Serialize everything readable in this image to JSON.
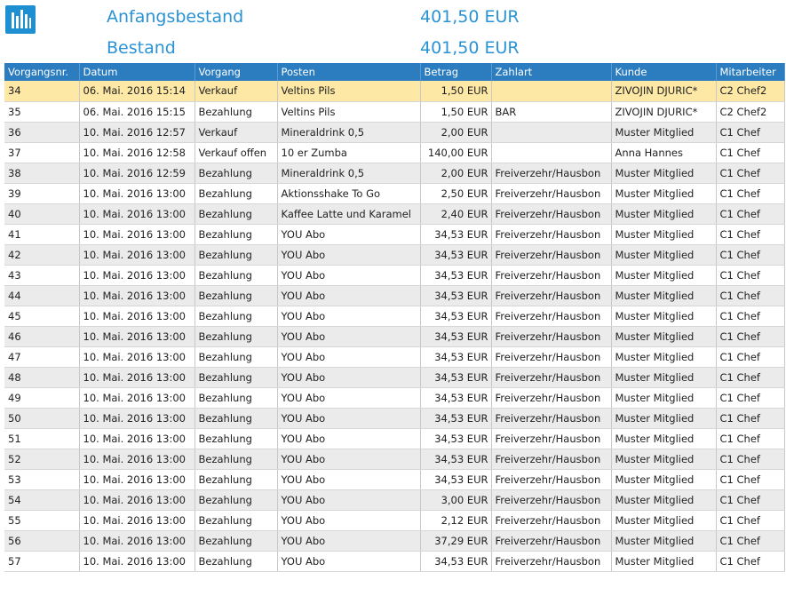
{
  "summary": {
    "opening_label": "Anfangsbestand",
    "opening_value": "401,50 EUR",
    "balance_label": "Bestand",
    "balance_value": "401,50 EUR"
  },
  "table": {
    "columns": [
      "Vorgangsnr.",
      "Datum",
      "Vorgang",
      "Posten",
      "Betrag",
      "Zahlart",
      "Kunde",
      "Mitarbeiter"
    ],
    "rows": [
      [
        "34",
        "06. Mai. 2016 15:14",
        "Verkauf",
        "Veltins Pils",
        "1,50 EUR",
        "",
        "ZIVOJIN DJURIC*",
        "C2 Chef2"
      ],
      [
        "35",
        "06. Mai. 2016 15:15",
        "Bezahlung",
        "Veltins Pils",
        "1,50 EUR",
        "BAR",
        "ZIVOJIN DJURIC*",
        "C2 Chef2"
      ],
      [
        "36",
        "10. Mai. 2016 12:57",
        "Verkauf",
        "Mineraldrink 0,5",
        "2,00 EUR",
        "",
        "Muster Mitglied",
        "C1 Chef"
      ],
      [
        "37",
        "10. Mai. 2016 12:58",
        "Verkauf offen",
        "10 er Zumba",
        "140,00 EUR",
        "",
        "Anna Hannes",
        "C1 Chef"
      ],
      [
        "38",
        "10. Mai. 2016 12:59",
        "Bezahlung",
        "Mineraldrink 0,5",
        "2,00 EUR",
        "Freiverzehr/Hausbon",
        "Muster Mitglied",
        "C1 Chef"
      ],
      [
        "39",
        "10. Mai. 2016 13:00",
        "Bezahlung",
        "Aktionsshake To Go",
        "2,50 EUR",
        "Freiverzehr/Hausbon",
        "Muster Mitglied",
        "C1 Chef"
      ],
      [
        "40",
        "10. Mai. 2016 13:00",
        "Bezahlung",
        "Kaffee Latte und Karamel",
        "2,40 EUR",
        "Freiverzehr/Hausbon",
        "Muster Mitglied",
        "C1 Chef"
      ],
      [
        "41",
        "10. Mai. 2016 13:00",
        "Bezahlung",
        "YOU Abo",
        "34,53 EUR",
        "Freiverzehr/Hausbon",
        "Muster Mitglied",
        "C1 Chef"
      ],
      [
        "42",
        "10. Mai. 2016 13:00",
        "Bezahlung",
        "YOU Abo",
        "34,53 EUR",
        "Freiverzehr/Hausbon",
        "Muster Mitglied",
        "C1 Chef"
      ],
      [
        "43",
        "10. Mai. 2016 13:00",
        "Bezahlung",
        "YOU Abo",
        "34,53 EUR",
        "Freiverzehr/Hausbon",
        "Muster Mitglied",
        "C1 Chef"
      ],
      [
        "44",
        "10. Mai. 2016 13:00",
        "Bezahlung",
        "YOU Abo",
        "34,53 EUR",
        "Freiverzehr/Hausbon",
        "Muster Mitglied",
        "C1 Chef"
      ],
      [
        "45",
        "10. Mai. 2016 13:00",
        "Bezahlung",
        "YOU Abo",
        "34,53 EUR",
        "Freiverzehr/Hausbon",
        "Muster Mitglied",
        "C1 Chef"
      ],
      [
        "46",
        "10. Mai. 2016 13:00",
        "Bezahlung",
        "YOU Abo",
        "34,53 EUR",
        "Freiverzehr/Hausbon",
        "Muster Mitglied",
        "C1 Chef"
      ],
      [
        "47",
        "10. Mai. 2016 13:00",
        "Bezahlung",
        "YOU Abo",
        "34,53 EUR",
        "Freiverzehr/Hausbon",
        "Muster Mitglied",
        "C1 Chef"
      ],
      [
        "48",
        "10. Mai. 2016 13:00",
        "Bezahlung",
        "YOU Abo",
        "34,53 EUR",
        "Freiverzehr/Hausbon",
        "Muster Mitglied",
        "C1 Chef"
      ],
      [
        "49",
        "10. Mai. 2016 13:00",
        "Bezahlung",
        "YOU Abo",
        "34,53 EUR",
        "Freiverzehr/Hausbon",
        "Muster Mitglied",
        "C1 Chef"
      ],
      [
        "50",
        "10. Mai. 2016 13:00",
        "Bezahlung",
        "YOU Abo",
        "34,53 EUR",
        "Freiverzehr/Hausbon",
        "Muster Mitglied",
        "C1 Chef"
      ],
      [
        "51",
        "10. Mai. 2016 13:00",
        "Bezahlung",
        "YOU Abo",
        "34,53 EUR",
        "Freiverzehr/Hausbon",
        "Muster Mitglied",
        "C1 Chef"
      ],
      [
        "52",
        "10. Mai. 2016 13:00",
        "Bezahlung",
        "YOU Abo",
        "34,53 EUR",
        "Freiverzehr/Hausbon",
        "Muster Mitglied",
        "C1 Chef"
      ],
      [
        "53",
        "10. Mai. 2016 13:00",
        "Bezahlung",
        "YOU Abo",
        "34,53 EUR",
        "Freiverzehr/Hausbon",
        "Muster Mitglied",
        "C1 Chef"
      ],
      [
        "54",
        "10. Mai. 2016 13:00",
        "Bezahlung",
        "YOU Abo",
        "3,00 EUR",
        "Freiverzehr/Hausbon",
        "Muster Mitglied",
        "C1 Chef"
      ],
      [
        "55",
        "10. Mai. 2016 13:00",
        "Bezahlung",
        "YOU Abo",
        "2,12 EUR",
        "Freiverzehr/Hausbon",
        "Muster Mitglied",
        "C1 Chef"
      ],
      [
        "56",
        "10. Mai. 2016 13:00",
        "Bezahlung",
        "YOU Abo",
        "37,29 EUR",
        "Freiverzehr/Hausbon",
        "Muster Mitglied",
        "C1 Chef"
      ],
      [
        "57",
        "10. Mai. 2016 13:00",
        "Bezahlung",
        "YOU Abo",
        "34,53 EUR",
        "Freiverzehr/Hausbon",
        "Muster Mitglied",
        "C1 Chef"
      ]
    ],
    "selected_row": 0
  },
  "icons": {
    "logo": "bar-chart-icon"
  },
  "colors": {
    "accent": "#2a93d5",
    "header_bg": "#2c7dbf",
    "row_alt": "#ebebeb",
    "row_selected": "#fde8a6"
  }
}
